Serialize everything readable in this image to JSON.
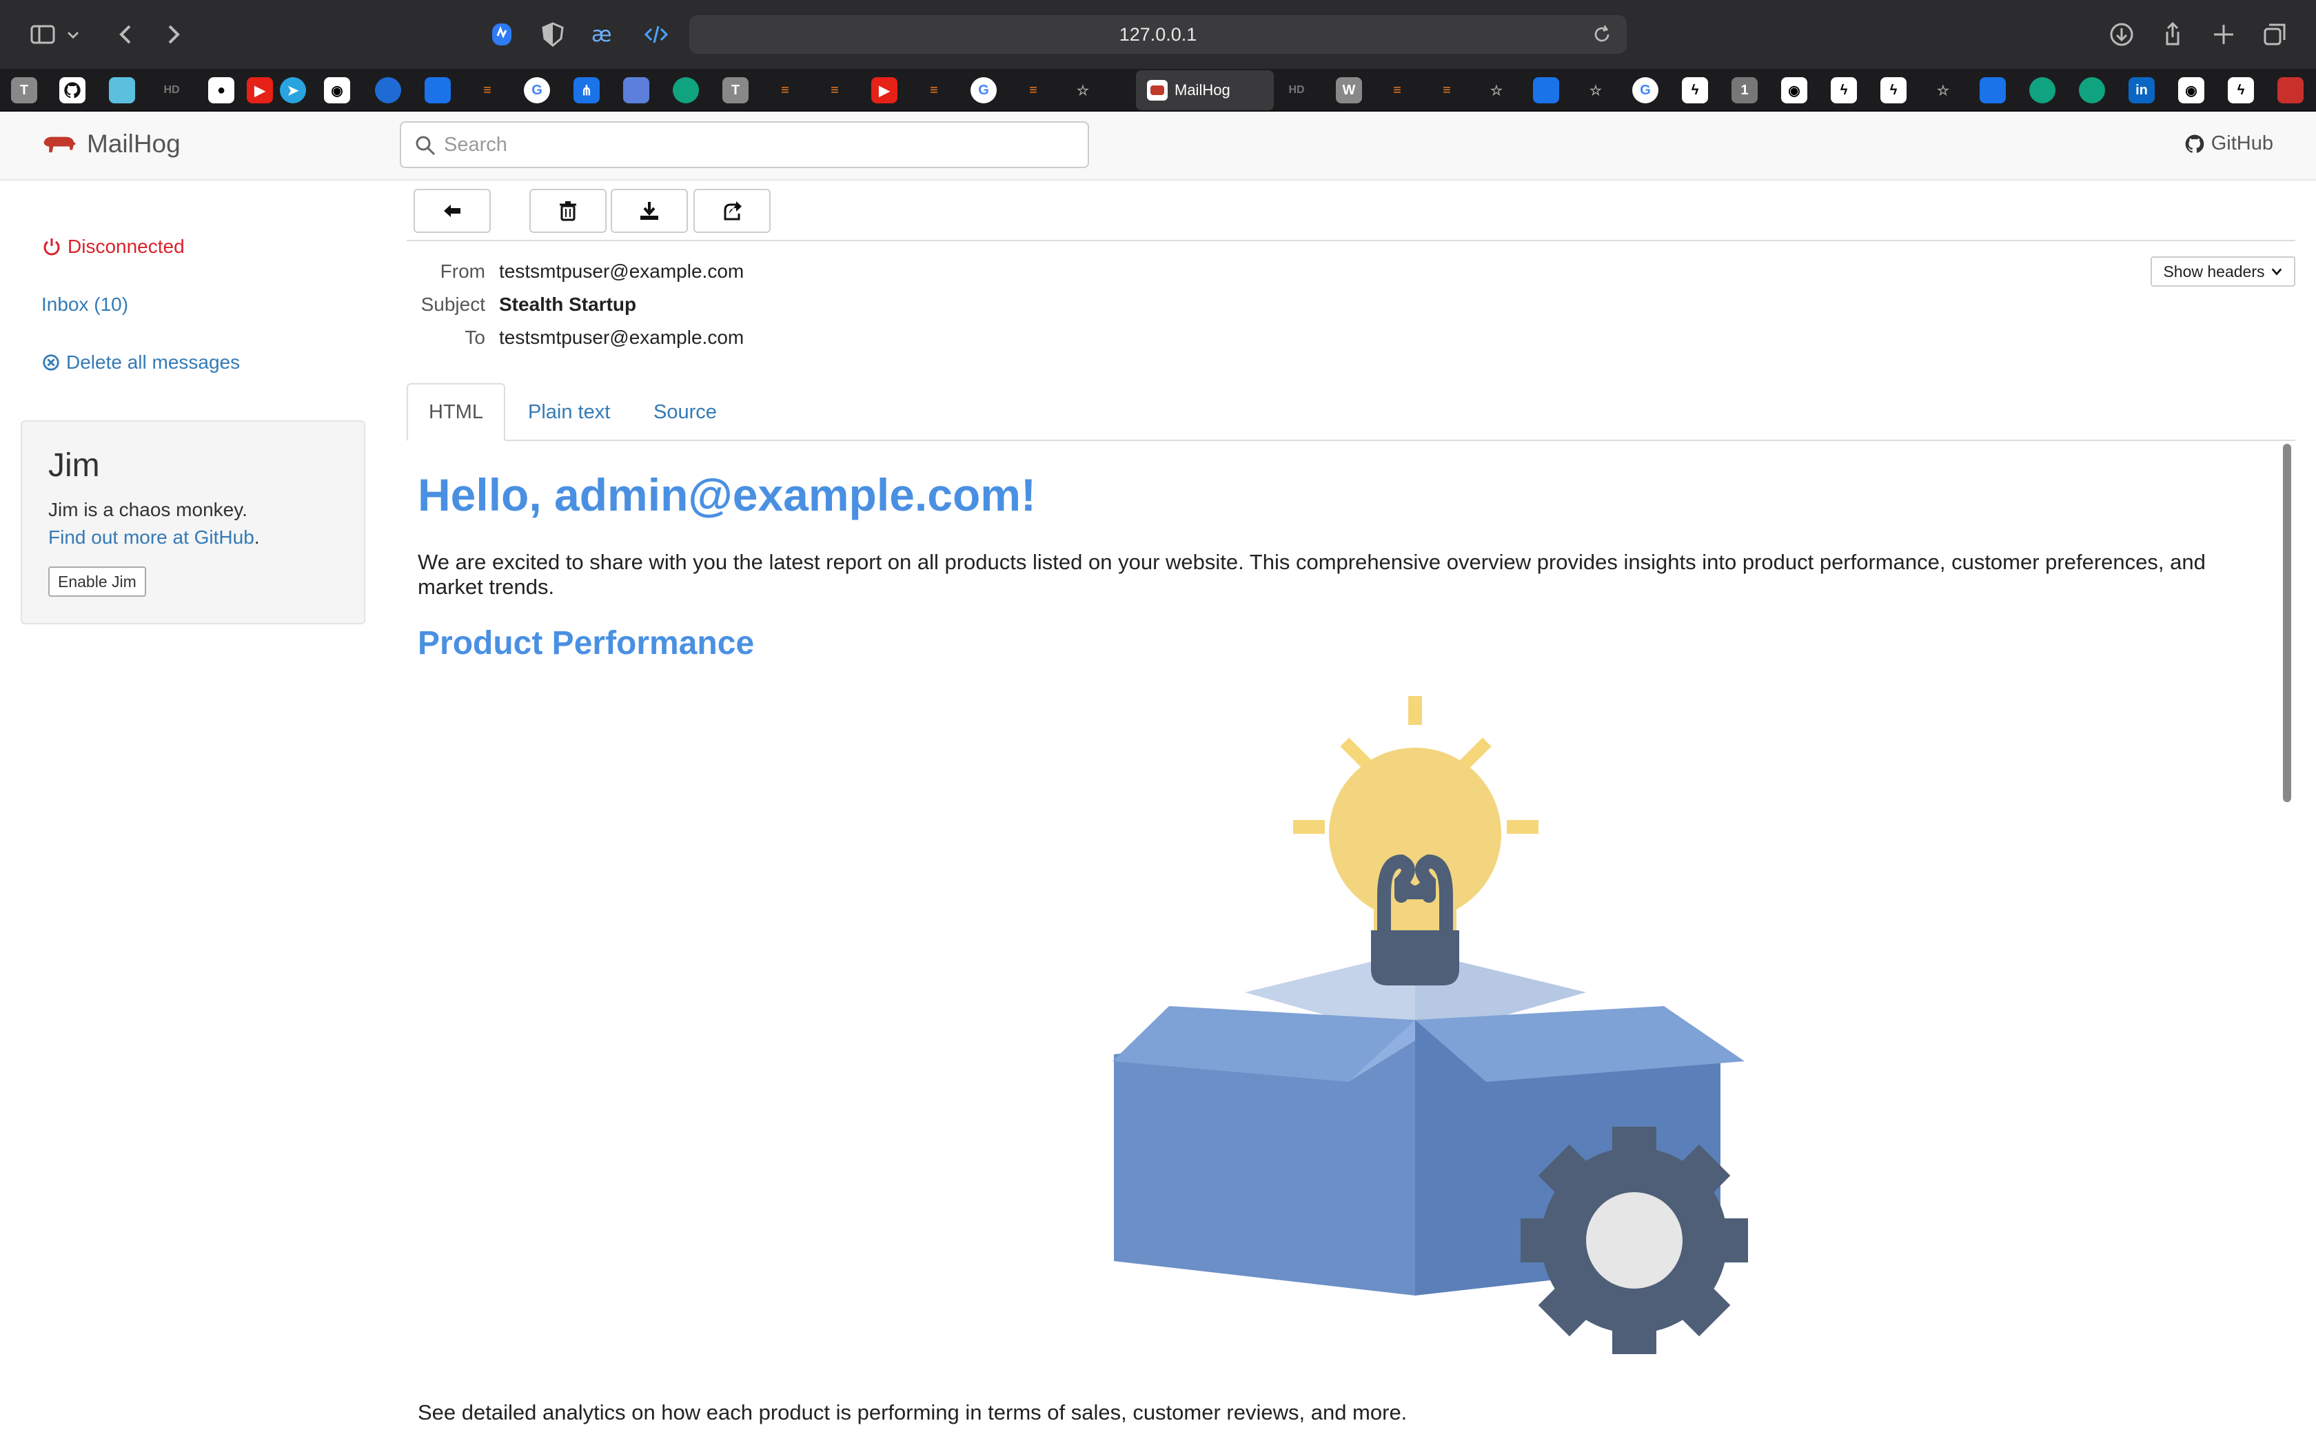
{
  "browser": {
    "url": "127.0.0.1",
    "active_tab_label": "MailHog"
  },
  "navbar": {
    "brand": "MailHog",
    "search_placeholder": "Search",
    "github_label": "GitHub"
  },
  "sidebar": {
    "status": "Disconnected",
    "inbox": "Inbox (10)",
    "delete_all": "Delete all messages",
    "jim": {
      "title": "Jim",
      "text": "Jim is a chaos monkey.",
      "link": "Find out more at GitHub",
      "link_suffix": ".",
      "button": "Enable Jim"
    }
  },
  "message": {
    "from_label": "From",
    "from": "testsmtpuser@example.com",
    "subject_label": "Subject",
    "subject": "Stealth Startup",
    "to_label": "To",
    "to": "testsmtpuser@example.com",
    "show_headers": "Show headers",
    "tabs": [
      "HTML",
      "Plain text",
      "Source"
    ]
  },
  "email": {
    "heading": "Hello, admin@example.com!",
    "intro": "We are excited to share with you the latest report on all products listed on your website. This comprehensive overview provides insights into product performance, customer preferences, and market trends.",
    "section_title": "Product Performance",
    "section_text": "See detailed analytics on how each product is performing in terms of sales, customer reviews, and more."
  },
  "colors": {
    "accent": "#4a90e2",
    "link": "#337ab7",
    "danger": "#d9222a"
  }
}
